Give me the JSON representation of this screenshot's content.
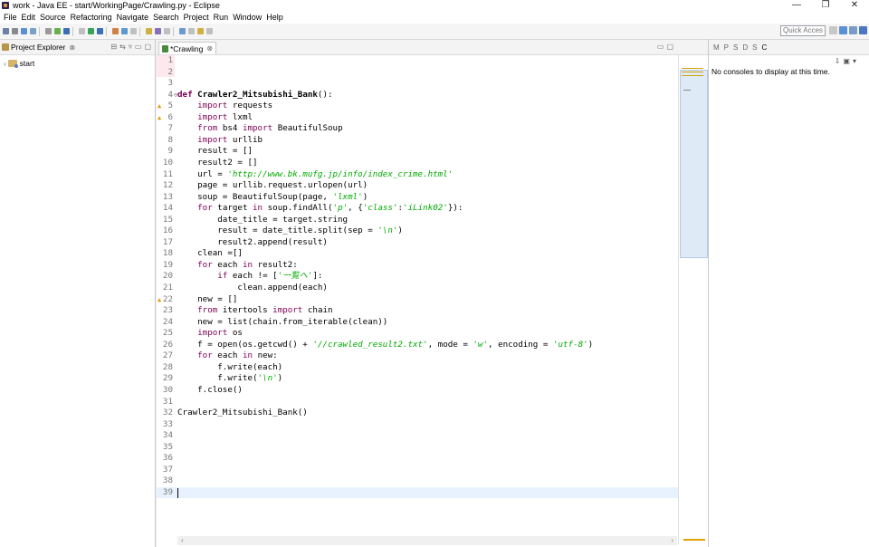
{
  "window": {
    "title": "work - Java EE - start/WorkingPage/Crawling.py - Eclipse",
    "controls": [
      "—",
      "❐",
      "✕"
    ]
  },
  "menu": {
    "items": [
      "File",
      "Edit",
      "Source",
      "Refactoring",
      "Navigate",
      "Search",
      "Project",
      "Run",
      "Window",
      "Help"
    ]
  },
  "toolbar": {
    "quick_access_placeholder": "Quick Access"
  },
  "project_explorer": {
    "title": "Project Explorer",
    "close": "⊗",
    "items": [
      {
        "label": "start"
      }
    ]
  },
  "editor": {
    "tab_title": "*Crawling",
    "tab_close": "⊗",
    "lines": [
      {
        "n": "1",
        "html": ""
      },
      {
        "n": "2",
        "html": ""
      },
      {
        "n": "3",
        "html": ""
      },
      {
        "n": "4",
        "html": "<span class='kw bold'>def</span> <span class='bold'>Crawler2_Mitsubishi_Bank</span>():"
      },
      {
        "n": "5",
        "html": "    <span class='kw'>import</span> requests",
        "warn": true
      },
      {
        "n": "6",
        "html": "    <span class='kw'>import</span> lxml",
        "warn": true
      },
      {
        "n": "7",
        "html": "    <span class='kw'>from</span> bs4 <span class='kw'>import</span> BeautifulSoup"
      },
      {
        "n": "8",
        "html": "    <span class='kw'>import</span> urllib"
      },
      {
        "n": "9",
        "html": "    result = []"
      },
      {
        "n": "10",
        "html": "    result2 = []"
      },
      {
        "n": "11",
        "html": "    url = <span class='str2'>'http://www.bk.mufg.jp/info/index_crime.html'</span>"
      },
      {
        "n": "12",
        "html": "    page = urllib.request.urlopen(url)"
      },
      {
        "n": "13",
        "html": "    soup = BeautifulSoup(page, <span class='str2'>'lxml'</span>)"
      },
      {
        "n": "14",
        "html": "    <span class='kw'>for</span> target <span class='kw'>in</span> soup.findAll(<span class='str2'>'p'</span>, {<span class='str2'>'class'</span>:<span class='str2'>'iLink02'</span>}):"
      },
      {
        "n": "15",
        "html": "        date_title = target.string"
      },
      {
        "n": "16",
        "html": "        result = date_title.split(sep = <span class='str2'>'\\n'</span>)"
      },
      {
        "n": "17",
        "html": "        result2.append(result)"
      },
      {
        "n": "18",
        "html": "    clean =[]"
      },
      {
        "n": "19",
        "html": "    <span class='kw'>for</span> each <span class='kw'>in</span> result2:"
      },
      {
        "n": "20",
        "html": "        <span class='kw'>if</span> each != [<span class='str2'>'一覧へ'</span>]:"
      },
      {
        "n": "21",
        "html": "            clean.append(each)"
      },
      {
        "n": "22",
        "html": "    new = []",
        "warn": true
      },
      {
        "n": "23",
        "html": "    <span class='kw'>from</span> itertools <span class='kw'>import</span> chain"
      },
      {
        "n": "24",
        "html": "    new = list(chain.from_iterable(clean))"
      },
      {
        "n": "25",
        "html": "    <span class='kw'>import</span> os"
      },
      {
        "n": "26",
        "html": "    f = open(os.getcwd() + <span class='str2'>'//crawled_result2.txt'</span>, mode = <span class='str2'>'w'</span>, encoding = <span class='str2'>'utf-8'</span>)"
      },
      {
        "n": "27",
        "html": "    <span class='kw'>for</span> each <span class='kw'>in</span> new:"
      },
      {
        "n": "28",
        "html": "        f.write(each)"
      },
      {
        "n": "29",
        "html": "        f.write(<span class='str2'>'\\n'</span>)"
      },
      {
        "n": "30",
        "html": "    f.close()"
      },
      {
        "n": "31",
        "html": ""
      },
      {
        "n": "32",
        "html": "Crawler2_Mitsubishi_Bank()"
      },
      {
        "n": "33",
        "html": ""
      },
      {
        "n": "34",
        "html": ""
      },
      {
        "n": "35",
        "html": ""
      },
      {
        "n": "36",
        "html": ""
      },
      {
        "n": "37",
        "html": ""
      },
      {
        "n": "38",
        "html": ""
      },
      {
        "n": "39",
        "html": "",
        "current": true
      }
    ]
  },
  "console": {
    "tabs": [
      "M",
      "P",
      "S",
      "D",
      "S",
      "C"
    ],
    "active_tab": "C",
    "message": "No consoles to display at this time."
  },
  "colors": {
    "keyword": "#7f0055",
    "string": "#2a00ff",
    "current_line": "#e8f2fe",
    "warning": "#e0a000"
  }
}
